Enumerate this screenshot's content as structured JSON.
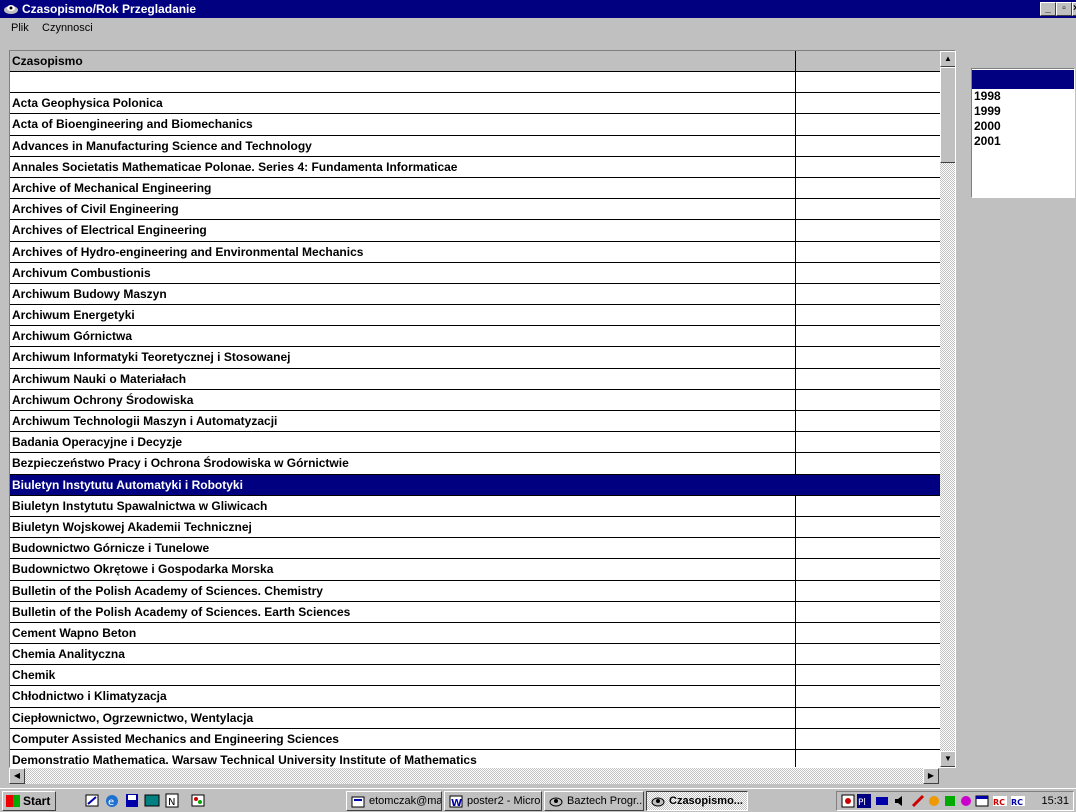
{
  "window": {
    "title": "Czasopismo/Rok Przegladanie"
  },
  "menu": {
    "items": [
      "Plik",
      "Czynnosci"
    ]
  },
  "grid": {
    "header": {
      "col1": "Czasopismo",
      "col2": ""
    },
    "rows": [
      "",
      "Acta Geophysica Polonica",
      "Acta of Bioengineering and Biomechanics",
      "Advances in Manufacturing Science and Technology",
      "Annales Societatis Mathematicae Polonae. Series 4: Fundamenta Informaticae",
      "Archive of Mechanical Engineering",
      "Archives of Civil Engineering",
      "Archives of Electrical Engineering",
      "Archives of Hydro-engineering and Environmental Mechanics",
      "Archivum Combustionis",
      "Archiwum Budowy Maszyn",
      "Archiwum Energetyki",
      "Archiwum Górnictwa",
      "Archiwum Informatyki Teoretycznej i Stosowanej",
      "Archiwum Nauki o Materiałach",
      "Archiwum Ochrony Środowiska",
      "Archiwum Technologii Maszyn i Automatyzacji",
      "Badania Operacyjne i Decyzje",
      "Bezpieczeństwo Pracy i Ochrona Środowiska w Górnictwie",
      "Biuletyn Instytutu Automatyki i Robotyki",
      "Biuletyn Instytutu Spawalnictwa w Gliwicach",
      "Biuletyn Wojskowej Akademii Technicznej",
      "Budownictwo Górnicze i Tunelowe",
      "Budownictwo Okrętowe i Gospodarka Morska",
      "Bulletin of the Polish Academy of Sciences. Chemistry",
      "Bulletin of the Polish Academy of Sciences. Earth Sciences",
      "Cement Wapno Beton",
      "Chemia Analityczna",
      "Chemik",
      "Chłodnictwo i Klimatyzacja",
      "Ciepłownictwo, Ogrzewnictwo, Wentylacja",
      "Computer Assisted Mechanics and Engineering Sciences",
      "Demonstratio Mathematica. Warsaw Technical University Institute of Mathematics"
    ],
    "selected_row": "Biuletyn Instytutu Automatyki i Robotyki"
  },
  "years": {
    "items": [
      "1998",
      "1999",
      "2000",
      "2001"
    ]
  },
  "taskbar": {
    "start_label": "Start",
    "tasks": [
      {
        "label": "etomczak@ma...",
        "icon": "mail-icon",
        "active": false
      },
      {
        "label": "poster2 - Micro...",
        "icon": "word-icon",
        "active": false
      },
      {
        "label": "Baztech Progr...",
        "icon": "app-icon",
        "active": false
      },
      {
        "label": "Czasopismo...",
        "icon": "app-icon",
        "active": true
      }
    ],
    "clock": "15:31"
  },
  "colors": {
    "titlebar": "#000080",
    "selection": "#000080",
    "face": "#c0c0c0"
  }
}
